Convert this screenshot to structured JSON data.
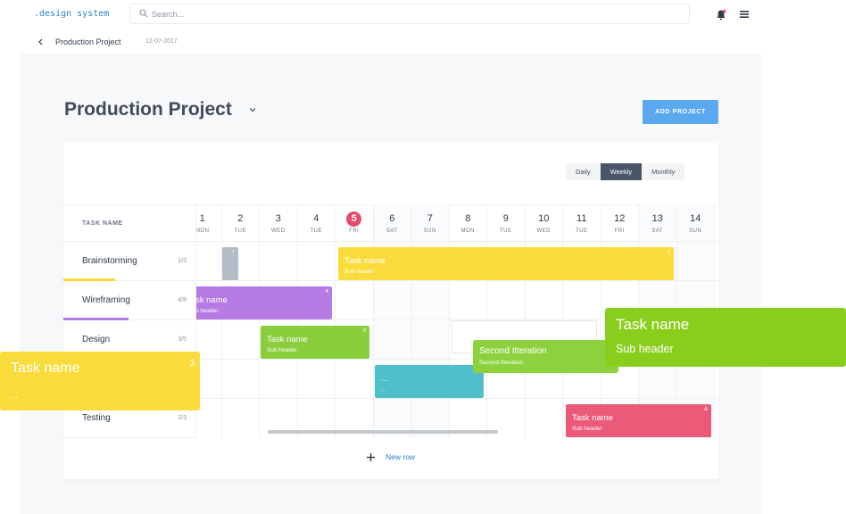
{
  "app": {
    "logo": ".design system"
  },
  "search": {
    "placeholder": "Search..."
  },
  "breadcrumb": {
    "title": "Production Project",
    "date": "12-07-2017"
  },
  "page": {
    "title": "Production Project",
    "add_button": "ADD PROJECT"
  },
  "views": [
    {
      "label": "Daily",
      "active": false
    },
    {
      "label": "Weekly",
      "active": true
    },
    {
      "label": "Monthly",
      "active": false
    }
  ],
  "table": {
    "task_header": "TASK NAME",
    "tasks": [
      {
        "name": "Brainstorming",
        "count": "1/3",
        "color": "#f9dc3c"
      },
      {
        "name": "Wireframing",
        "count": "4/8",
        "color": "#b57be3"
      },
      {
        "name": "Design",
        "count": "3/5"
      },
      {
        "name": "",
        "count": ""
      },
      {
        "name": "Testing",
        "count": "2/3"
      }
    ],
    "days": [
      {
        "num": "1",
        "dow": "MON",
        "today": false,
        "weekend": false
      },
      {
        "num": "2",
        "dow": "TUE",
        "today": false,
        "weekend": false
      },
      {
        "num": "3",
        "dow": "WED",
        "today": false,
        "weekend": false
      },
      {
        "num": "4",
        "dow": "TUE",
        "today": false,
        "weekend": false
      },
      {
        "num": "5",
        "dow": "FRI",
        "today": true,
        "weekend": false
      },
      {
        "num": "6",
        "dow": "SAT",
        "today": false,
        "weekend": true
      },
      {
        "num": "7",
        "dow": "SUN",
        "today": false,
        "weekend": true
      },
      {
        "num": "8",
        "dow": "MON",
        "today": false,
        "weekend": false
      },
      {
        "num": "9",
        "dow": "TUE",
        "today": false,
        "weekend": false
      },
      {
        "num": "10",
        "dow": "WED",
        "today": false,
        "weekend": false
      },
      {
        "num": "11",
        "dow": "TUE",
        "today": false,
        "weekend": false
      },
      {
        "num": "12",
        "dow": "FRI",
        "today": false,
        "weekend": false
      },
      {
        "num": "13",
        "dow": "SAT",
        "today": false,
        "weekend": true
      },
      {
        "num": "14",
        "dow": "SUN",
        "today": false,
        "weekend": true
      }
    ],
    "bars": [
      {
        "id": "brainstorm-stub",
        "title": "",
        "sub": "",
        "num": "+",
        "color": "#b3bcc7"
      },
      {
        "id": "brainstorm-main",
        "title": "Task name",
        "sub": "Sub header",
        "num": "6",
        "color": "#f9dc3c"
      },
      {
        "id": "wireframe-main",
        "title": "sk name",
        "sub": "b header",
        "num": "4",
        "color": "#b57be3"
      },
      {
        "id": "design-main",
        "title": "Task name",
        "sub": "Sub header",
        "num": "3",
        "color": "#8ace3c"
      },
      {
        "id": "row4-main",
        "title": "...",
        "sub": "...",
        "num": "",
        "color": "#4fbfca"
      },
      {
        "id": "testing-main",
        "title": "Task name",
        "sub": "Sub header",
        "num": "&",
        "color": "#ec5a7a"
      }
    ],
    "new_row": "New row"
  },
  "floating": {
    "green": {
      "title": "Task name",
      "sub": "Sub header",
      "color": "#8ace1d"
    },
    "yellow": {
      "title": "Task name",
      "sub": "...",
      "num": "3",
      "color": "#f9dc3c"
    },
    "second": {
      "title": "Second Itteration",
      "sub": "Second Itteration",
      "color": "#8dd23e"
    }
  }
}
